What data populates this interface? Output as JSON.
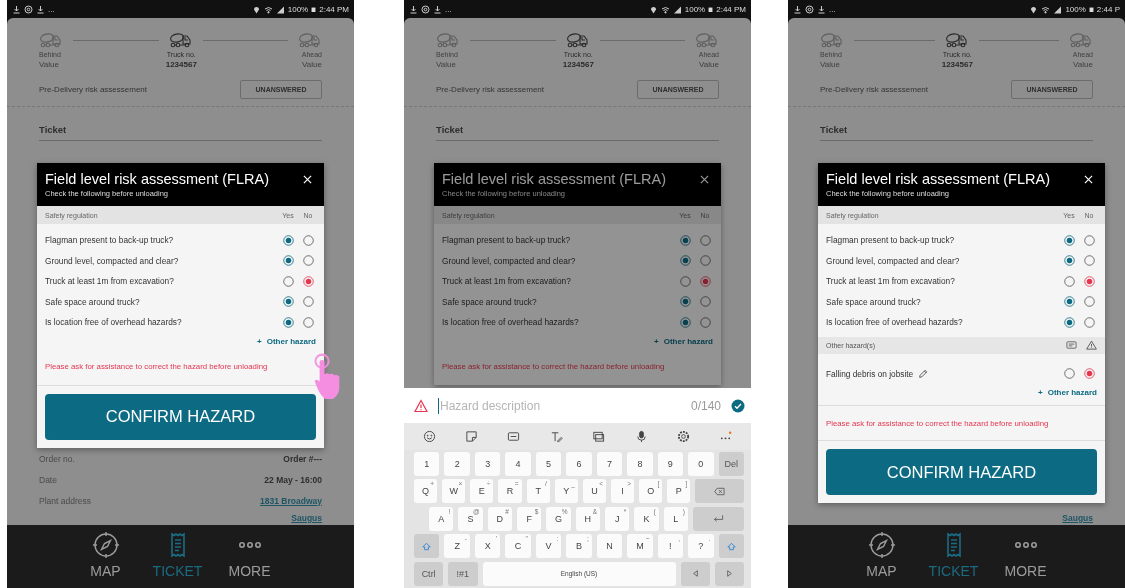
{
  "phones": [
    {
      "status_bar": {
        "overflow": "...",
        "battery": "100%",
        "time": "2:44 PM"
      },
      "truck_header": {
        "behind_label": "Behind",
        "behind_value": "Value",
        "truck_label": "Truck no.",
        "truck_number": "1234567",
        "ahead_label": "Ahead",
        "ahead_value": "Value"
      },
      "pre_delivery": {
        "label": "Pre-Delivery risk assessement",
        "status_button": "UNANSWERED"
      },
      "ticket_heading": "Ticket",
      "details": [
        {
          "label": "Order no.",
          "value": "Order #---",
          "kind": "plain"
        },
        {
          "label": "Date",
          "value": "22 May - 16:00",
          "kind": "plain"
        },
        {
          "label": "Plant address",
          "value": "1831 Broadway",
          "kind": "link"
        },
        {
          "value": "Saugus",
          "kind": "link"
        }
      ],
      "modal": {
        "title": "Field level risk assessment (FLRA)",
        "subtitle": "Check the following before unloading",
        "column_header": "Safety regulation",
        "yes_label": "Yes",
        "no_label": "No",
        "questions": [
          {
            "text": "Flagman present to back-up truck?",
            "yes_selected": true,
            "no_selected": false
          },
          {
            "text": "Ground level, compacted and clear?",
            "yes_selected": true,
            "no_selected": false
          },
          {
            "text": "Truck at least 1m from excavation?",
            "yes_selected": false,
            "no_selected": true
          },
          {
            "text": "Safe space around truck?",
            "yes_selected": true,
            "no_selected": false
          },
          {
            "text": "Is location free of overhead hazards?",
            "yes_selected": true,
            "no_selected": false
          }
        ],
        "add_hazard": {
          "icon": "+",
          "label": "Other hazard"
        },
        "warning": "Please ask for assistance to correct the hazard before unloading",
        "confirm_button": "CONFIRM HAZARD",
        "touch_indicator": true
      },
      "bottom_nav": [
        {
          "kind": "map",
          "label": "MAP",
          "selected": false
        },
        {
          "kind": "ticket",
          "label": "TICKET",
          "selected": true
        },
        {
          "kind": "more",
          "label": "MORE",
          "selected": false
        }
      ]
    },
    {
      "status_bar": {
        "overflow": "...",
        "battery": "100%",
        "time": "2:44 PM"
      },
      "truck_header": {
        "behind_label": "Behind",
        "behind_value": "Value",
        "truck_label": "Truck no.",
        "truck_number": "1234567",
        "ahead_label": "Ahead",
        "ahead_value": "Value"
      },
      "pre_delivery": {
        "label": "Pre-Delivery risk assessement",
        "status_button": "UNANSWERED"
      },
      "ticket_heading": "Ticket",
      "modal": {
        "title": "Field level risk assessment (FLRA)",
        "subtitle": "Check the following before unloading",
        "column_header": "Safety regulation",
        "yes_label": "Yes",
        "no_label": "No",
        "dimmed": true,
        "questions": [
          {
            "text": "Flagman present to back-up truck?",
            "yes_selected": true,
            "no_selected": false
          },
          {
            "text": "Ground level, compacted and clear?",
            "yes_selected": true,
            "no_selected": false
          },
          {
            "text": "Truck at least 1m from excavation?",
            "yes_selected": false,
            "no_selected": true
          },
          {
            "text": "Safe space around truck?",
            "yes_selected": true,
            "no_selected": false
          },
          {
            "text": "Is location free of overhead hazards?",
            "yes_selected": true,
            "no_selected": false
          }
        ],
        "add_hazard": {
          "icon": "+",
          "label": "Other hazard"
        },
        "warning": "Please ask for assistance to correct the hazard before unloading"
      },
      "keyboard": {
        "placeholder": "Hazard description",
        "counter": "0/140",
        "rows": [
          [
            {
              "kind": "char",
              "label": "1"
            },
            {
              "kind": "char",
              "label": "2"
            },
            {
              "kind": "char",
              "label": "3"
            },
            {
              "kind": "char",
              "label": "4"
            },
            {
              "kind": "char",
              "label": "5"
            },
            {
              "kind": "char",
              "label": "6"
            },
            {
              "kind": "char",
              "label": "7"
            },
            {
              "kind": "char",
              "label": "8"
            },
            {
              "kind": "char",
              "label": "9"
            },
            {
              "kind": "char",
              "label": "0"
            },
            {
              "kind": "func",
              "label": "Del"
            }
          ],
          [
            {
              "kind": "char",
              "label": "Q",
              "hint": "+"
            },
            {
              "kind": "char",
              "label": "W",
              "hint": "×"
            },
            {
              "kind": "char",
              "label": "E",
              "hint": "÷"
            },
            {
              "kind": "char",
              "label": "R",
              "hint": "="
            },
            {
              "kind": "char",
              "label": "T",
              "hint": "/"
            },
            {
              "kind": "char",
              "label": "Y",
              "hint": "_"
            },
            {
              "kind": "char",
              "label": "U",
              "hint": "<"
            },
            {
              "kind": "char",
              "label": "I",
              "hint": ">"
            },
            {
              "kind": "char",
              "label": "O",
              "hint": "["
            },
            {
              "kind": "char",
              "label": "P",
              "hint": "]"
            },
            {
              "kind": "backspace"
            }
          ],
          [
            {
              "kind": "char",
              "label": "A",
              "hint": "!"
            },
            {
              "kind": "char",
              "label": "S",
              "hint": "@"
            },
            {
              "kind": "char",
              "label": "D",
              "hint": "#"
            },
            {
              "kind": "char",
              "label": "F",
              "hint": "$"
            },
            {
              "kind": "char",
              "label": "G",
              "hint": "%"
            },
            {
              "kind": "char",
              "label": "H",
              "hint": "&"
            },
            {
              "kind": "char",
              "label": "J",
              "hint": "*"
            },
            {
              "kind": "char",
              "label": "K",
              "hint": "("
            },
            {
              "kind": "char",
              "label": "L",
              "hint": ")"
            },
            {
              "kind": "enter"
            }
          ],
          [
            {
              "kind": "shift"
            },
            {
              "kind": "char",
              "label": "Z",
              "hint": "-"
            },
            {
              "kind": "char",
              "label": "X",
              "hint": "'"
            },
            {
              "kind": "char",
              "label": "C",
              "hint": "\""
            },
            {
              "kind": "char",
              "label": "V",
              "hint": ":"
            },
            {
              "kind": "char",
              "label": "B",
              "hint": ";"
            },
            {
              "kind": "char",
              "label": "N"
            },
            {
              "kind": "char",
              "label": "M",
              "hint": "~"
            },
            {
              "kind": "char",
              "label": "!",
              "hint": ","
            },
            {
              "kind": "char",
              "label": "?",
              "hint": "."
            },
            {
              "kind": "shift"
            }
          ]
        ],
        "bottom_row": [
          {
            "kind": "func",
            "label": "Ctrl"
          },
          {
            "kind": "func",
            "label": "!#1"
          },
          {
            "kind": "space",
            "label": "English (US)"
          },
          {
            "kind": "left"
          },
          {
            "kind": "right"
          }
        ]
      }
    },
    {
      "status_bar": {
        "overflow": "...",
        "battery": "100%",
        "time": "2:44 P"
      },
      "truck_header": {
        "behind_label": "Behind",
        "behind_value": "Value",
        "truck_label": "Truck no.",
        "truck_number": "1234567",
        "ahead_label": "Ahead",
        "ahead_value": "Value"
      },
      "pre_delivery": {
        "label": "Pre-Delivery risk assessement",
        "status_button": "UNANSWERED"
      },
      "ticket_heading": "Ticket",
      "details": [
        {
          "value": "Saugus",
          "kind": "link"
        }
      ],
      "modal": {
        "title": "Field level risk assessment (FLRA)",
        "subtitle": "Check the following before unloading",
        "column_header": "Safety regulation",
        "yes_label": "Yes",
        "no_label": "No",
        "questions": [
          {
            "text": "Flagman present to back-up truck?",
            "yes_selected": true,
            "no_selected": false
          },
          {
            "text": "Ground level, compacted and clear?",
            "yes_selected": true,
            "no_selected": false
          },
          {
            "text": "Truck at least 1m from excavation?",
            "yes_selected": false,
            "no_selected": true
          },
          {
            "text": "Safe space around truck?",
            "yes_selected": true,
            "no_selected": false
          },
          {
            "text": "Is location free of overhead hazards?",
            "yes_selected": true,
            "no_selected": false
          }
        ],
        "other_hazards": {
          "header": "Other hazard(s)",
          "items": [
            {
              "text": "Falling debris on jobsite",
              "yes_selected": false,
              "no_selected": true
            }
          ]
        },
        "add_hazard": {
          "icon": "+",
          "label": "Other hazard"
        },
        "warning": "Please ask for assistance to correct the hazard before unloading",
        "confirm_button": "CONFIRM HAZARD"
      },
      "bottom_nav": [
        {
          "kind": "map",
          "label": "MAP",
          "selected": false
        },
        {
          "kind": "ticket",
          "label": "TICKET",
          "selected": true
        },
        {
          "kind": "more",
          "label": "MORE",
          "selected": false
        }
      ]
    }
  ]
}
